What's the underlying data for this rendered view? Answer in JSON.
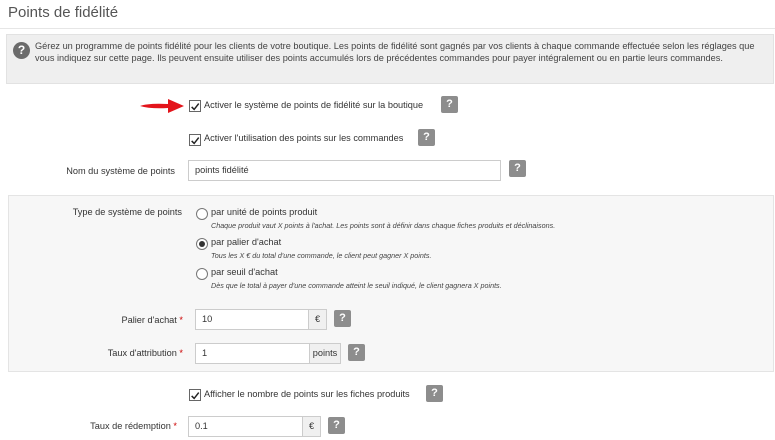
{
  "page": {
    "title": "Points de fidélité",
    "info": "Gérez un programme de points fidélité pour les clients de votre boutique. Les points de fidélité sont gagnés par vos clients à chaque commande effectuée selon les réglages que vous indiquez sur cette page. Ils peuvent ensuite utiliser des points accumulés lors de précédentes commandes pour payer intégralement ou en partie leurs commandes.",
    "info_icon": "?"
  },
  "help_glyph": "?",
  "settings": {
    "enable_label": "Activer le système de points de fidélité sur la boutique",
    "enable_checked": true,
    "use_label": "Activer l'utilisation des points sur les commandes",
    "use_checked": true,
    "name_label": "Nom du système de points",
    "name_value": "points fidélité",
    "show_label": "Afficher le nombre de points sur les fiches produits",
    "show_checked": true,
    "redeem_label": "Taux de rédemption",
    "redeem_value": "0.1",
    "redeem_unit": "€"
  },
  "type_panel": {
    "label": "Type de système de points",
    "options": [
      {
        "label": "par unité de points produit",
        "desc": "Chaque produit vaut X points à l'achat. Les points sont à définir dans chaque fiches produits et déclinaisons.",
        "selected": false
      },
      {
        "label": "par palier d'achat",
        "desc": "Tous les X € du total d'une commande, le client peut gagner X points.",
        "selected": true
      },
      {
        "label": "par seuil d'achat",
        "desc": "Dès que le total à payer d'une commande atteint le seuil indiqué, le client gagnera X points.",
        "selected": false
      }
    ],
    "palier_label": "Palier d'achat",
    "palier_value": "10",
    "palier_unit": "€",
    "taux_label": "Taux d'attribution",
    "taux_value": "1",
    "taux_unit": "points"
  },
  "required_mark": "*",
  "colors": {
    "arrow": "#e3141b",
    "help_button": "#8d8d8d",
    "panel_bg": "#f7f7f7",
    "info_bg": "#efefef"
  }
}
